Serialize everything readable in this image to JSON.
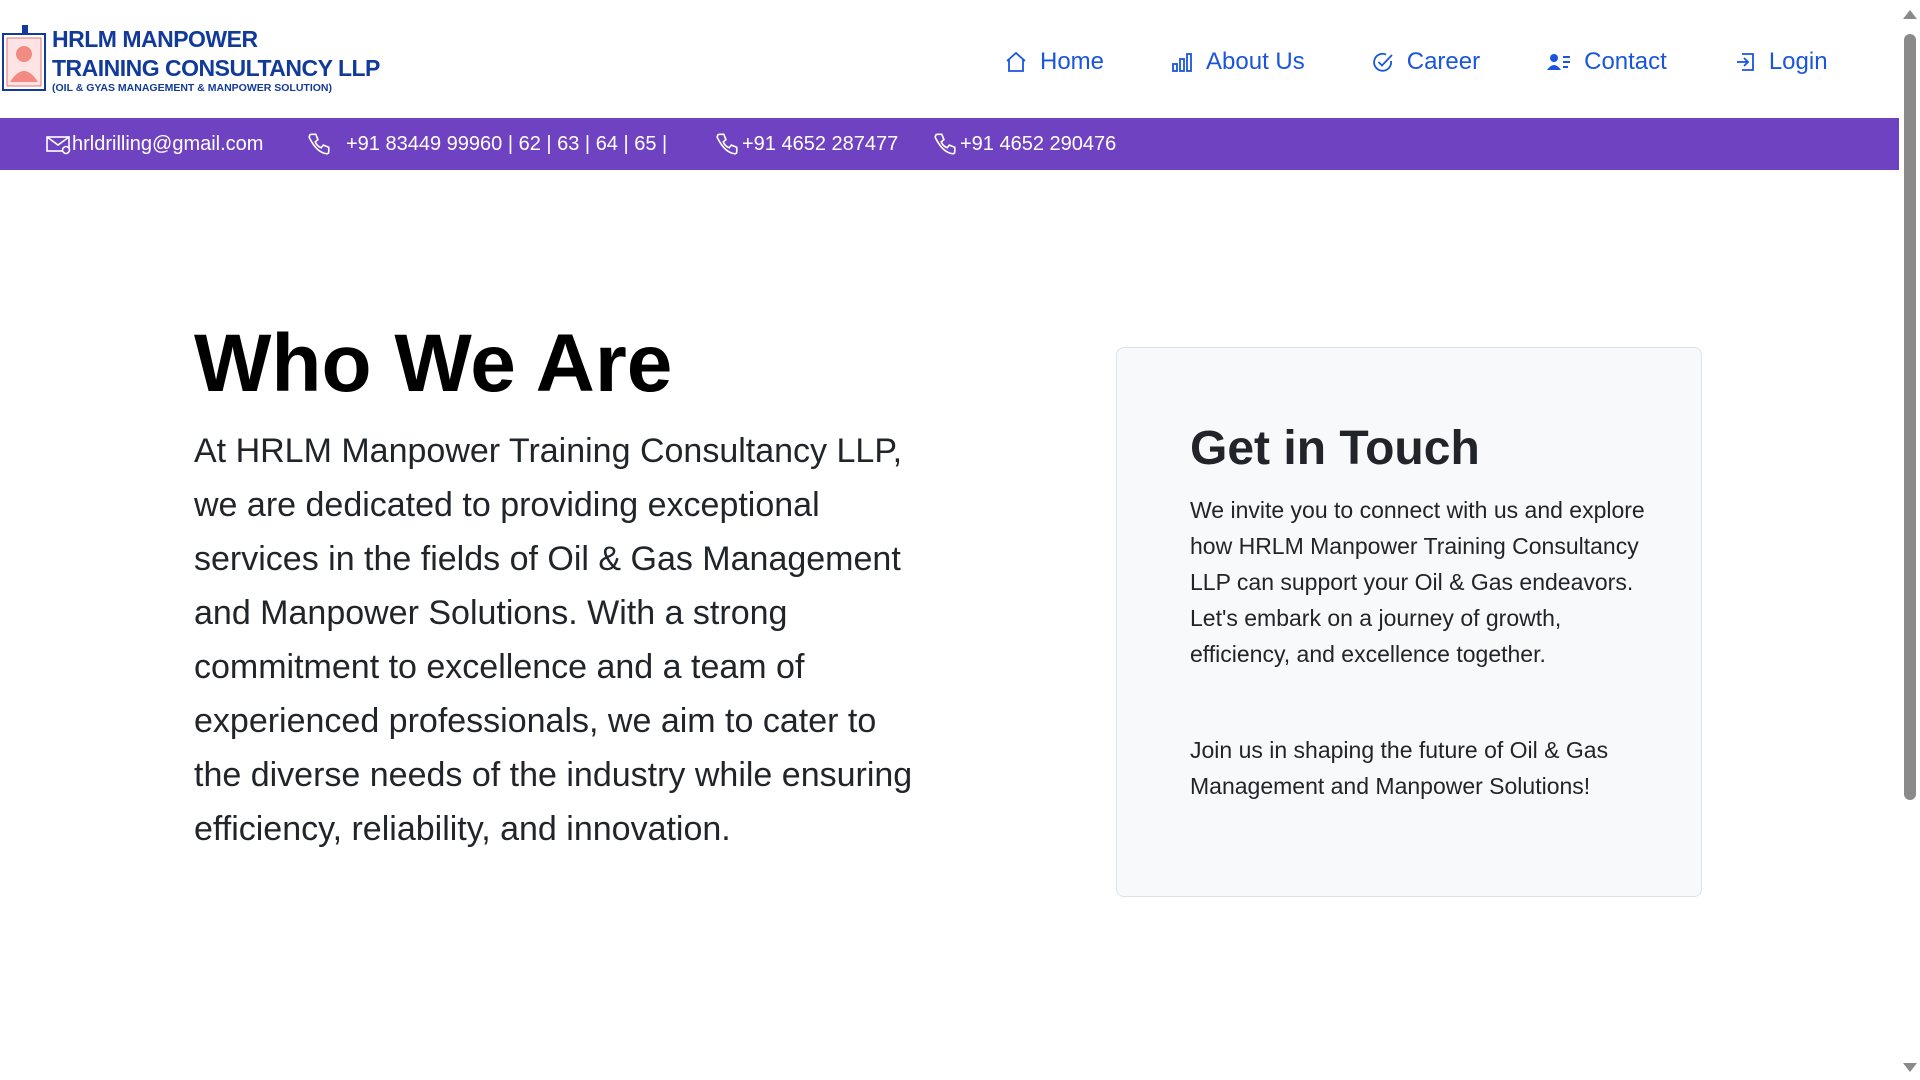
{
  "brand": {
    "line1": "HRLM MANPOWER",
    "line2": "TRAINING CONSULTANCY LLP",
    "line3": "(OIL & GYAS MANAGEMENT & MANPOWER SOLUTION)"
  },
  "nav": {
    "items": [
      {
        "label": "Home",
        "icon": "home-icon"
      },
      {
        "label": "About Us",
        "icon": "bar-chart-icon"
      },
      {
        "label": "Career",
        "icon": "check-circle-icon"
      },
      {
        "label": "Contact",
        "icon": "person-lines-icon"
      },
      {
        "label": "Login",
        "icon": "login-icon"
      }
    ]
  },
  "topbar": {
    "email": "hrldrilling@gmail.com",
    "phone1": "+91 83449 99960 | 62 | 63 | 64 | 65 |",
    "phone2": "+91 4652 287477",
    "phone3": "+91 4652 290476"
  },
  "who": {
    "title": "Who We Are",
    "text": "At HRLM Manpower Training Consultancy LLP, we are dedicated to providing exceptional services in the fields of Oil & Gas Management and Manpower Solutions. With a strong commitment to excellence and a team of experienced professionals, we aim to cater to the diverse needs of the industry while ensuring efficiency, reliability, and innovation."
  },
  "contact_card": {
    "title": "Get in Touch",
    "p1": "We invite you to connect with us and explore how HRLM Manpower Training Consultancy LLP can support your Oil & Gas endeavors. Let's embark on a journey of growth, efficiency, and excellence together.",
    "p2": "Join us in shaping the future of Oil & Gas Management and Manpower Solutions!"
  },
  "colors": {
    "brand_blue": "#123a9a",
    "nav_link": "#1a56db",
    "topbar_bg": "#6f42c1",
    "card_bg": "#f8f9fa"
  }
}
